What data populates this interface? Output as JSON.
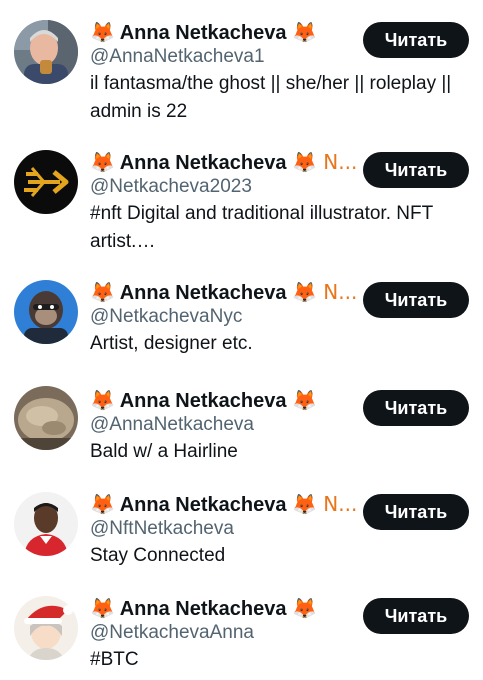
{
  "follow_label": "Читать",
  "accounts": [
    {
      "name": "Anna Netkacheva",
      "prefix_emoji": "🦊",
      "suffix": "🦊",
      "handle": "@AnnaNetkacheva1",
      "bio": "il fantasma/the ghost || she/her || roleplay || admin is 22",
      "avatar_icon": "photo-older-man-avatar"
    },
    {
      "name": "Anna Netkacheva",
      "prefix_emoji": "🦊",
      "suffix": "🦊 N...",
      "handle": "@Netkacheva2023",
      "bio": "#nft Digital and traditional illustrator. NFT artist.…",
      "avatar_icon": "gold-arrow-logo-avatar"
    },
    {
      "name": "Anna Netkacheva",
      "prefix_emoji": "🦊",
      "suffix": "🦊 N...",
      "handle": "@NetkachevaNyc",
      "bio": "Artist, designer etc.",
      "avatar_icon": "ape-nft-avatar"
    },
    {
      "name": "Anna Netkacheva",
      "prefix_emoji": "🦊",
      "suffix": "🦊",
      "handle": "@AnnaNetkacheva",
      "bio": "Bald w/ a Hairline",
      "avatar_icon": "stone-photo-avatar"
    },
    {
      "name": "Anna Netkacheva",
      "prefix_emoji": "🦊",
      "suffix": "🦊 N...",
      "handle": "@NftNetkacheva",
      "bio": "Stay Connected",
      "avatar_icon": "man-portrait-avatar"
    },
    {
      "name": "Anna Netkacheva",
      "prefix_emoji": "🦊",
      "suffix": "🦊",
      "handle": "@NetkachevaAnna",
      "bio": "#BTC",
      "avatar_icon": "anime-santa-hat-avatar"
    }
  ]
}
